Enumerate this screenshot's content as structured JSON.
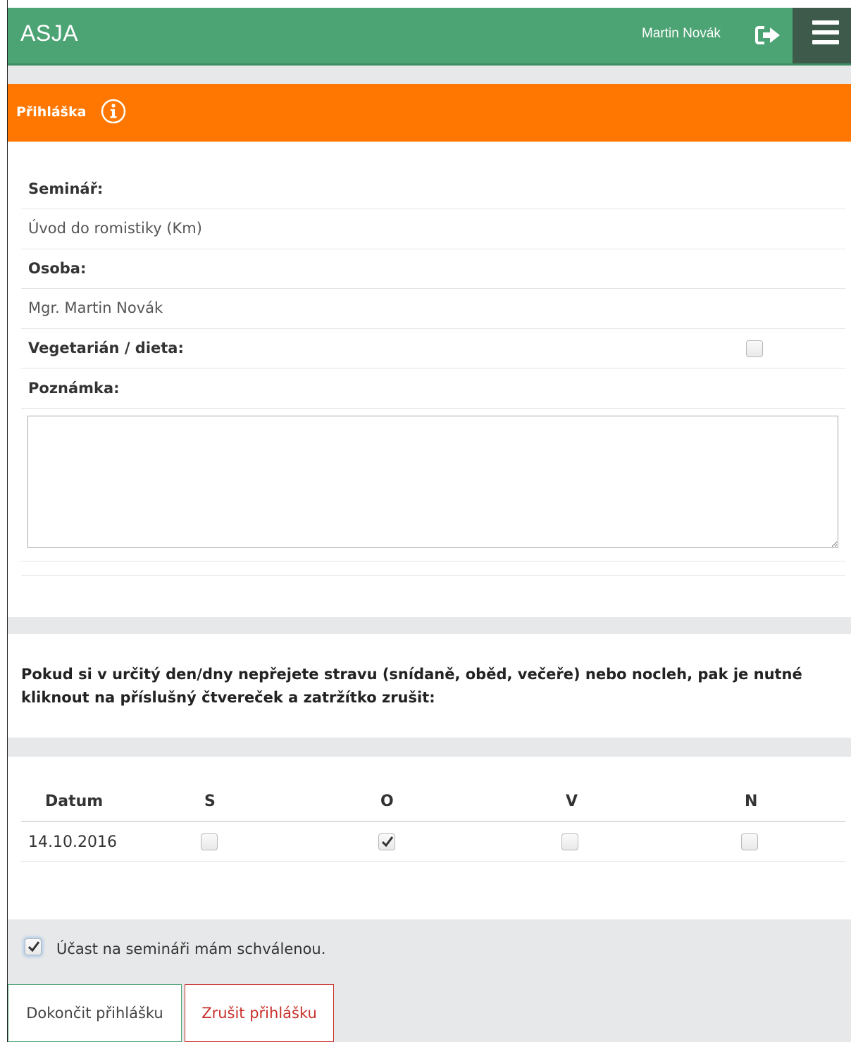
{
  "header": {
    "brand": "ASJA",
    "user_name": "Martin Novák"
  },
  "colors": {
    "header_bg": "#4ca374",
    "menu_bg": "#3d5a4a",
    "panel_header_bg": "#ff7700",
    "section_gray": "#e7e8e9",
    "cancel_red": "#c9302c"
  },
  "panel": {
    "title": "Přihláška"
  },
  "form": {
    "seminar_label": "Seminář:",
    "seminar_value": "Úvod do romistiky (Km)",
    "person_label": "Osoba:",
    "person_value": "Mgr. Martin Novák",
    "diet_label": "Vegetarián / dieta:",
    "diet_checked": false,
    "note_label": "Poznámka:",
    "note_value": ""
  },
  "meals": {
    "instruction": "Pokud si v určitý den/dny nepřejete stravu (snídaně, oběd, večeře) nebo nocleh, pak je nutné kliknout na příslušný čtvereček a zatržítko zrušit:",
    "columns": [
      "Datum",
      "S",
      "O",
      "V",
      "N"
    ],
    "rows": [
      {
        "date": "14.10.2016",
        "S": false,
        "O": true,
        "V": false,
        "N": false
      }
    ]
  },
  "approval": {
    "checked": true,
    "label": "Účast na semináři mám schválenou."
  },
  "actions": {
    "finish_label": "Dokončit přihlášku",
    "cancel_label": "Zrušit přihlášku"
  }
}
